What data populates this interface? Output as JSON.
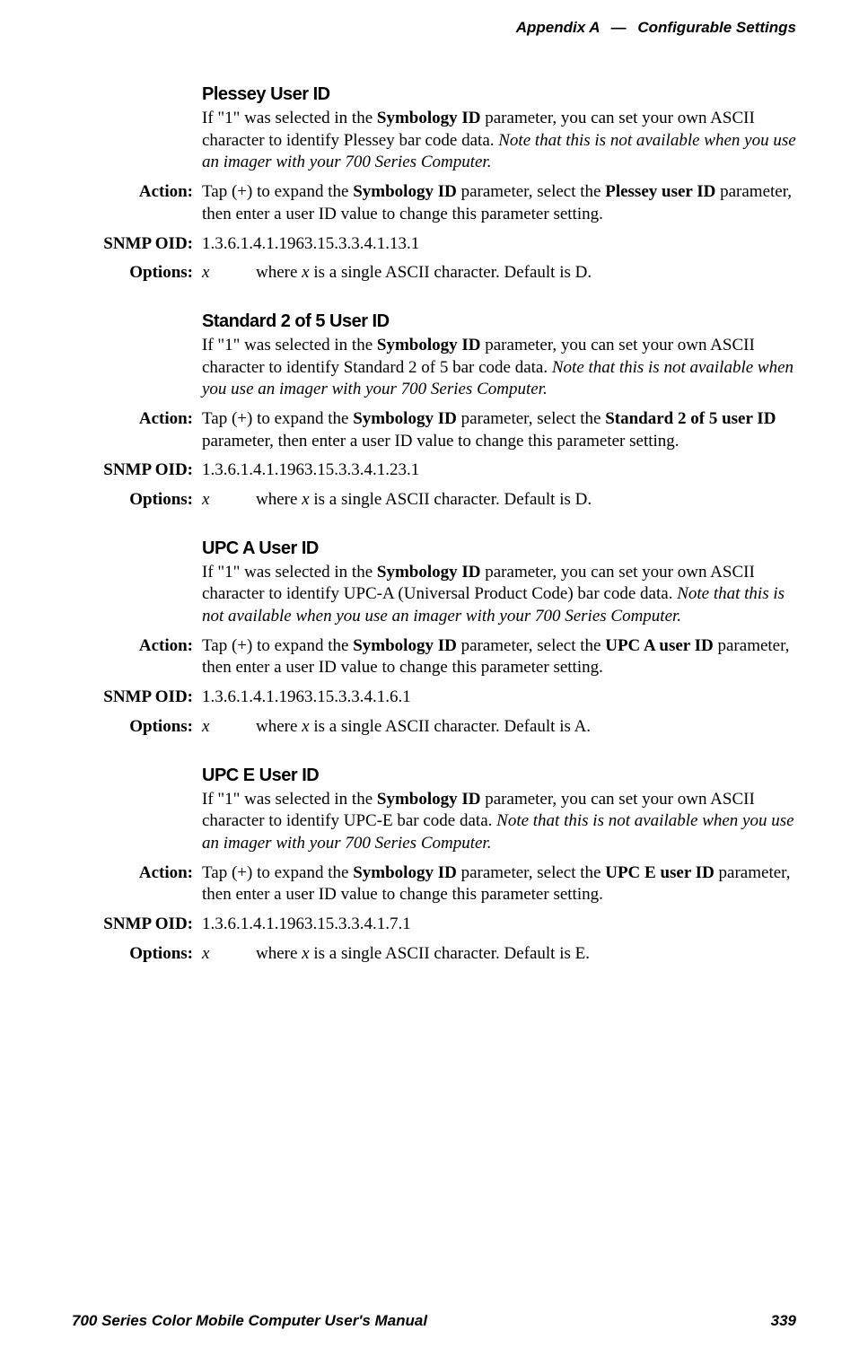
{
  "header": {
    "left": "Appendix A",
    "sep": "—",
    "right": "Configurable Settings"
  },
  "footer": {
    "manual": "700 Series Color Mobile Computer User's Manual",
    "page": "339"
  },
  "labels": {
    "action": "Action:",
    "snmp": "SNMP OID:",
    "options": "Options:"
  },
  "sections": [
    {
      "title": "Plessey User ID",
      "intro_pre": "If \"1\" was selected in the ",
      "intro_bold1": "Symbology ID",
      "intro_mid": " parameter, you can set your own ASCII character to identify Plessey bar code data. ",
      "intro_note": "Note that this is not available when you use an imager with your 700 Series Computer.",
      "action_pre": "Tap (+) to expand the ",
      "action_bold1": "Symbology ID",
      "action_mid": " parameter, select the ",
      "action_bold2": "Plessey user ID",
      "action_post": " parameter, then enter a user ID value to change this parameter setting.",
      "snmp": "1.3.6.1.4.1.1963.15.3.3.4.1.13.1",
      "opt_sym": "x",
      "opt_pre": "where ",
      "opt_x": "x",
      "opt_post": " is a single ASCII character. Default is D."
    },
    {
      "title": "Standard 2 of 5 User ID",
      "intro_pre": "If \"1\" was selected in the ",
      "intro_bold1": "Symbology ID",
      "intro_mid": " parameter, you can set your own ASCII character to identify Standard 2 of 5 bar code data. ",
      "intro_note": "Note that this is not available when you use an imager with your 700 Series Computer.",
      "action_pre": "Tap (+) to expand the ",
      "action_bold1": "Symbology ID",
      "action_mid": " parameter, select the ",
      "action_bold2": "Standard 2 of 5 user ID",
      "action_post": " parameter, then enter a user ID value to change this parameter setting.",
      "snmp": "1.3.6.1.4.1.1963.15.3.3.4.1.23.1",
      "opt_sym": "x",
      "opt_pre": "where ",
      "opt_x": "x",
      "opt_post": " is a single ASCII character. Default is D."
    },
    {
      "title": "UPC A User ID",
      "intro_pre": "If \"1\" was selected in the ",
      "intro_bold1": "Symbology ID",
      "intro_mid": " parameter, you can set your own ASCII character to identify UPC-A (Universal Product Code) bar code data. ",
      "intro_note": "Note that this is not available when you use an imager with your 700 Series Computer.",
      "action_pre": "Tap (+) to expand the ",
      "action_bold1": "Symbology ID",
      "action_mid": " parameter, select the ",
      "action_bold2": "UPC A user ID",
      "action_post": " parameter, then enter a user ID value to change this parameter setting.",
      "snmp": "1.3.6.1.4.1.1963.15.3.3.4.1.6.1",
      "opt_sym": "x",
      "opt_pre": "where ",
      "opt_x": "x",
      "opt_post": " is a single ASCII character. Default is A."
    },
    {
      "title": "UPC E User ID",
      "intro_pre": "If \"1\" was selected in the ",
      "intro_bold1": "Symbology ID",
      "intro_mid": " parameter, you can set your own ASCII character to identify UPC-E bar code data. ",
      "intro_note": "Note that this is not available when you use an imager with your 700 Series Computer.",
      "action_pre": "Tap (+) to expand the ",
      "action_bold1": "Symbology ID",
      "action_mid": " parameter, select the ",
      "action_bold2": "UPC E user ID",
      "action_post": " parameter, then enter a user ID value to change this parameter setting.",
      "snmp": "1.3.6.1.4.1.1963.15.3.3.4.1.7.1",
      "opt_sym": "x",
      "opt_pre": "where ",
      "opt_x": "x",
      "opt_post": " is a single ASCII character. Default is E."
    }
  ]
}
